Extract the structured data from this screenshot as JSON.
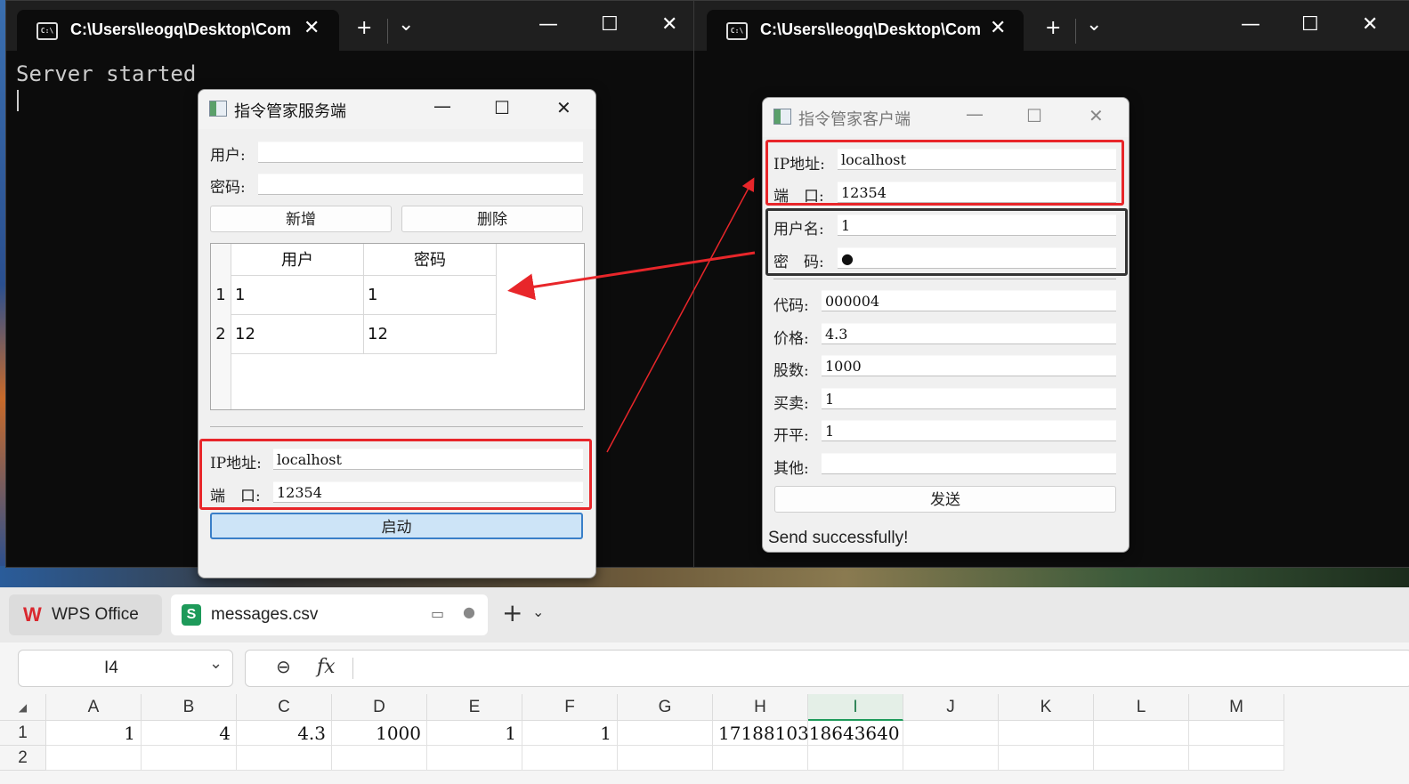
{
  "terminal_left": {
    "tab_title": "C:\\Users\\leogq\\Desktop\\Com",
    "tab_icon": "C:\\",
    "output_line": "Server started"
  },
  "terminal_right": {
    "tab_title": "C:\\Users\\leogq\\Desktop\\Com",
    "tab_icon": "C:\\"
  },
  "terminal_controls": {
    "close": "✕",
    "new_tab": "+",
    "dropdown": "⌄",
    "minimize": "—",
    "maximize": "☐",
    "window_close": "✕"
  },
  "server": {
    "title": "指令管家服务端",
    "user_label": "用户:",
    "user_value": "",
    "password_label": "密码:",
    "password_value": "",
    "add_button": "新增",
    "delete_button": "删除",
    "table": {
      "headers": [
        "用户",
        "密码"
      ],
      "rows": [
        {
          "index": "1",
          "user": "1",
          "password": "1"
        },
        {
          "index": "2",
          "user": "12",
          "password": "12"
        }
      ]
    },
    "ip_label": "IP地址:",
    "ip_value": "localhost",
    "port_label": "端　口:",
    "port_value": "12354",
    "start_button": "启动"
  },
  "client": {
    "title": "指令管家客户端",
    "ip_label": "IP地址:",
    "ip_value": "localhost",
    "port_label": "端　口:",
    "port_value": "12354",
    "username_label": "用户名:",
    "username_value": "1",
    "password_label": "密　码:",
    "password_value": "●",
    "code_label": "代码:",
    "code_value": "000004",
    "price_label": "价格:",
    "price_value": "4.3",
    "shares_label": "股数:",
    "shares_value": "1000",
    "buysell_label": "买卖:",
    "buysell_value": "1",
    "openclose_label": "开平:",
    "openclose_value": "1",
    "other_label": "其他:",
    "other_value": "",
    "send_button": "发送",
    "status": "Send successfully!"
  },
  "wps": {
    "app_tab": "WPS Office",
    "file_tab": "messages.csv",
    "new_tab": "+",
    "cell_ref": "I4",
    "fx": "fx",
    "columns": [
      "A",
      "B",
      "C",
      "D",
      "E",
      "F",
      "G",
      "H",
      "I",
      "J",
      "K",
      "L",
      "M"
    ],
    "rows": [
      {
        "num": "1",
        "cells": [
          "1",
          "4",
          "4.3",
          "1000",
          "1",
          "1",
          "",
          "1718810318643640",
          "",
          "",
          "",
          "",
          ""
        ]
      },
      {
        "num": "2",
        "cells": [
          "",
          "",
          "",
          "",
          "",
          "",
          "",
          "",
          "",
          "",
          "",
          "",
          ""
        ]
      }
    ]
  },
  "colors": {
    "highlight_red": "#e8262a",
    "start_button_bg": "#cde4f7",
    "wps_red": "#d9282f",
    "sheet_green": "#1e9a5a"
  }
}
